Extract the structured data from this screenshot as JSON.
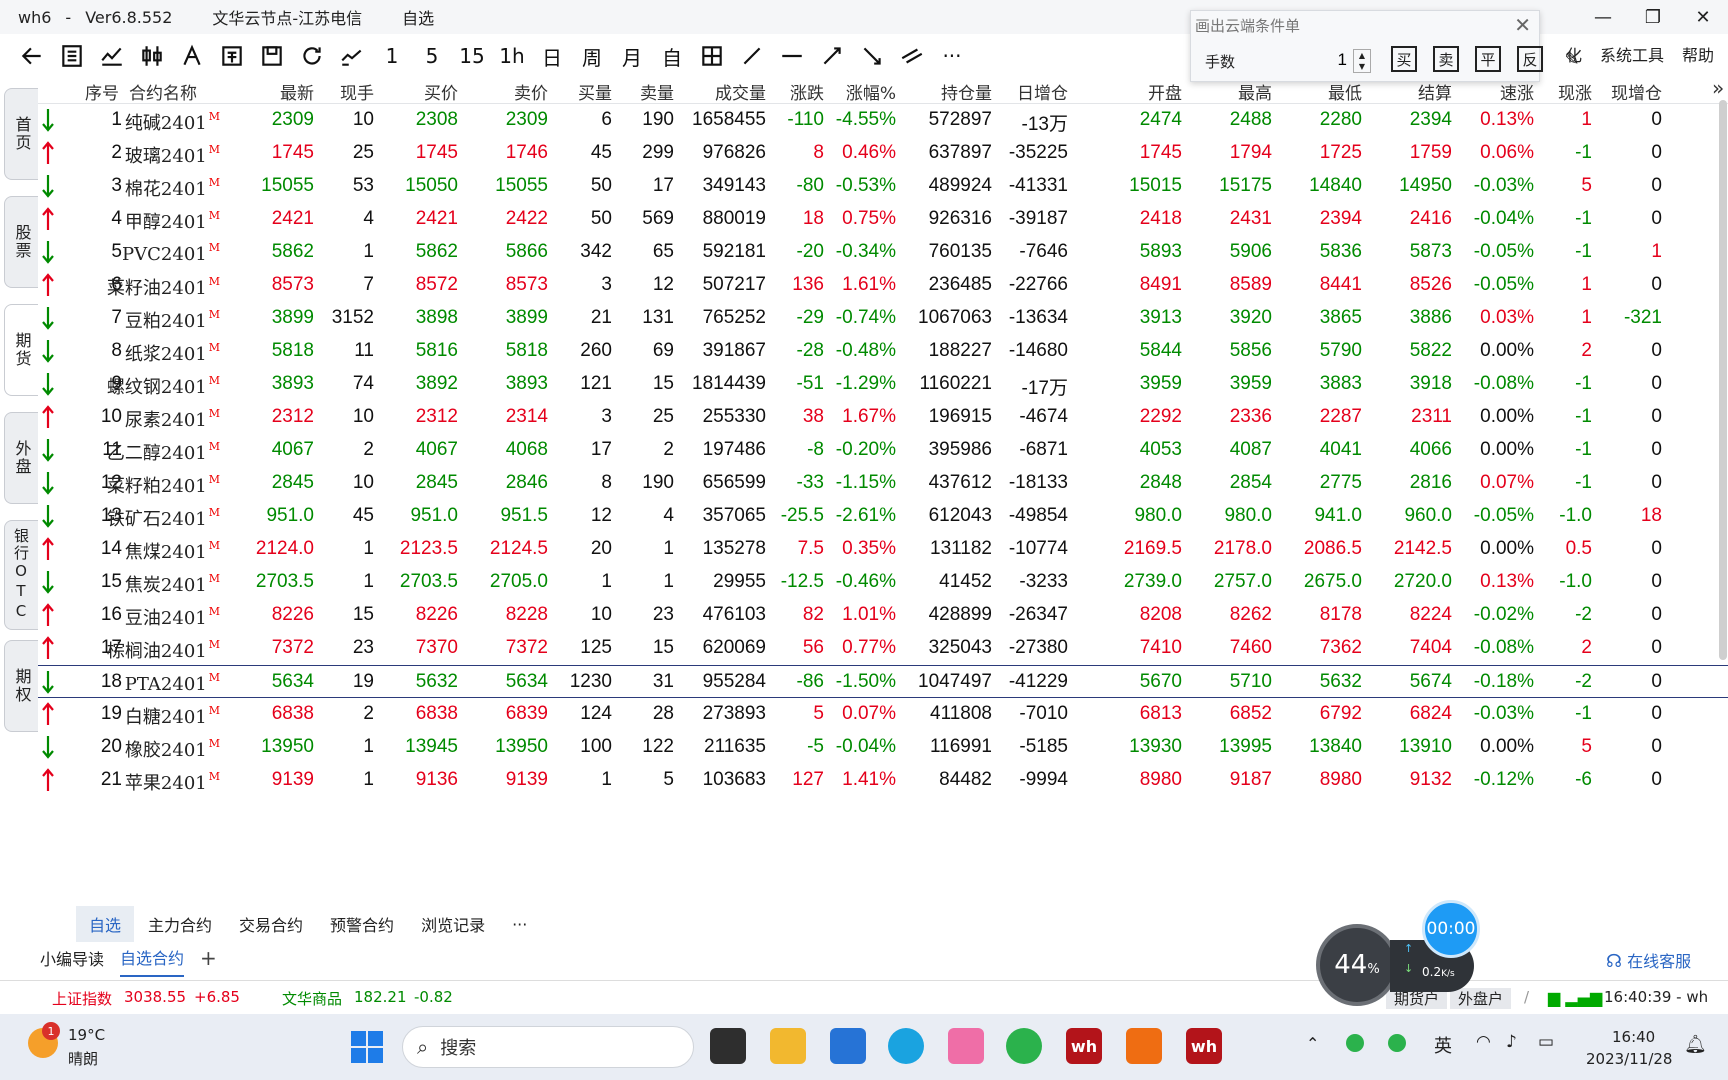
{
  "window": {
    "app": "wh6",
    "sep": "-",
    "version": "Ver6.8.552",
    "server": "文华云节点-江苏电信",
    "page": "自选",
    "controls": [
      "—",
      "❐",
      "✕"
    ]
  },
  "toolbar": {
    "buttons": [
      "back",
      "list",
      "line-chart",
      "candle",
      "k-line",
      "region",
      "save",
      "refresh",
      "indicator"
    ],
    "periods": [
      "1",
      "5",
      "15",
      "1h",
      "日",
      "周",
      "月",
      "自"
    ],
    "draw_tools": [
      "grid",
      "draw-line",
      "horizontal-line",
      "ray",
      "down-ray",
      "parallel",
      "more"
    ],
    "more": "···"
  },
  "right_menu": [
    "化",
    "系统工具",
    "帮助"
  ],
  "cond_panel": {
    "title": "画出云端条件单",
    "close": "✕",
    "qty_label": "手数",
    "qty_value": "1",
    "buttons": [
      "买",
      "卖",
      "平",
      "反"
    ],
    "pen": "✎"
  },
  "side_tabs": [
    "首页",
    "股票",
    "期货",
    "外盘",
    "银行OTC",
    "期权"
  ],
  "columns": [
    "序号",
    "合约名称",
    "最新",
    "现手",
    "买价",
    "卖价",
    "买量",
    "卖量",
    "成交量",
    "涨跌",
    "涨幅%",
    "持仓量",
    "日增仓",
    "开盘",
    "最高",
    "最低",
    "结算",
    "速涨",
    "现涨",
    "现增仓"
  ],
  "col_overflow": "»",
  "badge": "M",
  "rows": [
    {
      "no": "1",
      "name": "纯碱2401",
      "dir": "down",
      "last": "2309",
      "vol_now": "10",
      "bid": "2308",
      "ask": "2309",
      "bid_qty": "6",
      "ask_qty": "190",
      "volume": "1658455",
      "chg": "-110",
      "pct": "-4.55%",
      "oi": "572897",
      "oi_day": "-13万",
      "open": "2474",
      "high": "2488",
      "low": "2280",
      "settle": "2394",
      "speed": "0.13%",
      "now_chg": "1",
      "now_oi": "0"
    },
    {
      "no": "2",
      "name": "玻璃2401",
      "dir": "up",
      "last": "1745",
      "vol_now": "25",
      "bid": "1745",
      "ask": "1746",
      "bid_qty": "45",
      "ask_qty": "299",
      "volume": "976826",
      "chg": "8",
      "pct": "0.46%",
      "oi": "637897",
      "oi_day": "-35225",
      "open": "1745",
      "high": "1794",
      "low": "1725",
      "settle": "1759",
      "speed": "0.06%",
      "now_chg": "-1",
      "now_oi": "0"
    },
    {
      "no": "3",
      "name": "棉花2401",
      "dir": "down",
      "last": "15055",
      "vol_now": "53",
      "bid": "15050",
      "ask": "15055",
      "bid_qty": "50",
      "ask_qty": "17",
      "volume": "349143",
      "chg": "-80",
      "pct": "-0.53%",
      "oi": "489924",
      "oi_day": "-41331",
      "open": "15015",
      "high": "15175",
      "low": "14840",
      "settle": "14950",
      "speed": "-0.03%",
      "now_chg": "5",
      "now_oi": "0"
    },
    {
      "no": "4",
      "name": "甲醇2401",
      "dir": "up",
      "last": "2421",
      "vol_now": "4",
      "bid": "2421",
      "ask": "2422",
      "bid_qty": "50",
      "ask_qty": "569",
      "volume": "880019",
      "chg": "18",
      "pct": "0.75%",
      "oi": "926316",
      "oi_day": "-39187",
      "open": "2418",
      "high": "2431",
      "low": "2394",
      "settle": "2416",
      "speed": "-0.04%",
      "now_chg": "-1",
      "now_oi": "0"
    },
    {
      "no": "5",
      "name": "PVC2401",
      "dir": "down",
      "last": "5862",
      "vol_now": "1",
      "bid": "5862",
      "ask": "5866",
      "bid_qty": "342",
      "ask_qty": "65",
      "volume": "592181",
      "chg": "-20",
      "pct": "-0.34%",
      "oi": "760135",
      "oi_day": "-7646",
      "open": "5893",
      "high": "5906",
      "low": "5836",
      "settle": "5873",
      "speed": "-0.05%",
      "now_chg": "-1",
      "now_oi": "1"
    },
    {
      "no": "6",
      "name": "菜籽油2401",
      "dir": "up",
      "last": "8573",
      "vol_now": "7",
      "bid": "8572",
      "ask": "8573",
      "bid_qty": "3",
      "ask_qty": "12",
      "volume": "507217",
      "chg": "136",
      "pct": "1.61%",
      "oi": "236485",
      "oi_day": "-22766",
      "open": "8491",
      "high": "8589",
      "low": "8441",
      "settle": "8526",
      "speed": "-0.05%",
      "now_chg": "1",
      "now_oi": "0"
    },
    {
      "no": "7",
      "name": "豆粕2401",
      "dir": "down",
      "last": "3899",
      "vol_now": "3152",
      "bid": "3898",
      "ask": "3899",
      "bid_qty": "21",
      "ask_qty": "131",
      "volume": "765252",
      "chg": "-29",
      "pct": "-0.74%",
      "oi": "1067063",
      "oi_day": "-13634",
      "open": "3913",
      "high": "3920",
      "low": "3865",
      "settle": "3886",
      "speed": "0.03%",
      "now_chg": "1",
      "now_oi": "-321"
    },
    {
      "no": "8",
      "name": "纸浆2401",
      "dir": "down",
      "last": "5818",
      "vol_now": "11",
      "bid": "5816",
      "ask": "5818",
      "bid_qty": "260",
      "ask_qty": "69",
      "volume": "391867",
      "chg": "-28",
      "pct": "-0.48%",
      "oi": "188227",
      "oi_day": "-14680",
      "open": "5844",
      "high": "5856",
      "low": "5790",
      "settle": "5822",
      "speed": "0.00%",
      "now_chg": "2",
      "now_oi": "0"
    },
    {
      "no": "9",
      "name": "螺纹钢2401",
      "dir": "down",
      "last": "3893",
      "vol_now": "74",
      "bid": "3892",
      "ask": "3893",
      "bid_qty": "121",
      "ask_qty": "15",
      "volume": "1814439",
      "chg": "-51",
      "pct": "-1.29%",
      "oi": "1160221",
      "oi_day": "-17万",
      "open": "3959",
      "high": "3959",
      "low": "3883",
      "settle": "3918",
      "speed": "-0.08%",
      "now_chg": "-1",
      "now_oi": "0"
    },
    {
      "no": "10",
      "name": "尿素2401",
      "dir": "up",
      "last": "2312",
      "vol_now": "10",
      "bid": "2312",
      "ask": "2314",
      "bid_qty": "3",
      "ask_qty": "25",
      "volume": "255330",
      "chg": "38",
      "pct": "1.67%",
      "oi": "196915",
      "oi_day": "-4674",
      "open": "2292",
      "high": "2336",
      "low": "2287",
      "settle": "2311",
      "speed": "0.00%",
      "now_chg": "-1",
      "now_oi": "0"
    },
    {
      "no": "11",
      "name": "乙二醇2401",
      "dir": "down",
      "last": "4067",
      "vol_now": "2",
      "bid": "4067",
      "ask": "4068",
      "bid_qty": "17",
      "ask_qty": "2",
      "volume": "197486",
      "chg": "-8",
      "pct": "-0.20%",
      "oi": "395986",
      "oi_day": "-6871",
      "open": "4053",
      "high": "4087",
      "low": "4041",
      "settle": "4066",
      "speed": "0.00%",
      "now_chg": "-1",
      "now_oi": "0"
    },
    {
      "no": "12",
      "name": "菜籽粕2401",
      "dir": "down",
      "last": "2845",
      "vol_now": "10",
      "bid": "2845",
      "ask": "2846",
      "bid_qty": "8",
      "ask_qty": "190",
      "volume": "656599",
      "chg": "-33",
      "pct": "-1.15%",
      "oi": "437612",
      "oi_day": "-18133",
      "open": "2848",
      "high": "2854",
      "low": "2775",
      "settle": "2816",
      "speed": "0.07%",
      "now_chg": "-1",
      "now_oi": "0"
    },
    {
      "no": "13",
      "name": "铁矿石2401",
      "dir": "down",
      "last": "951.0",
      "vol_now": "45",
      "bid": "951.0",
      "ask": "951.5",
      "bid_qty": "12",
      "ask_qty": "4",
      "volume": "357065",
      "chg": "-25.5",
      "pct": "-2.61%",
      "oi": "612043",
      "oi_day": "-49854",
      "open": "980.0",
      "high": "980.0",
      "low": "941.0",
      "settle": "960.0",
      "speed": "-0.05%",
      "now_chg": "-1.0",
      "now_oi": "18"
    },
    {
      "no": "14",
      "name": "焦煤2401",
      "dir": "up",
      "last": "2124.0",
      "vol_now": "1",
      "bid": "2123.5",
      "ask": "2124.5",
      "bid_qty": "20",
      "ask_qty": "1",
      "volume": "135278",
      "chg": "7.5",
      "pct": "0.35%",
      "oi": "131182",
      "oi_day": "-10774",
      "open": "2169.5",
      "high": "2178.0",
      "low": "2086.5",
      "settle": "2142.5",
      "speed": "0.00%",
      "now_chg": "0.5",
      "now_oi": "0"
    },
    {
      "no": "15",
      "name": "焦炭2401",
      "dir": "down",
      "last": "2703.5",
      "vol_now": "1",
      "bid": "2703.5",
      "ask": "2705.0",
      "bid_qty": "1",
      "ask_qty": "1",
      "volume": "29955",
      "chg": "-12.5",
      "pct": "-0.46%",
      "oi": "41452",
      "oi_day": "-3233",
      "open": "2739.0",
      "high": "2757.0",
      "low": "2675.0",
      "settle": "2720.0",
      "speed": "0.13%",
      "now_chg": "-1.0",
      "now_oi": "0"
    },
    {
      "no": "16",
      "name": "豆油2401",
      "dir": "up",
      "last": "8226",
      "vol_now": "15",
      "bid": "8226",
      "ask": "8228",
      "bid_qty": "10",
      "ask_qty": "23",
      "volume": "476103",
      "chg": "82",
      "pct": "1.01%",
      "oi": "428899",
      "oi_day": "-26347",
      "open": "8208",
      "high": "8262",
      "low": "8178",
      "settle": "8224",
      "speed": "-0.02%",
      "now_chg": "-2",
      "now_oi": "0"
    },
    {
      "no": "17",
      "name": "棕榈油2401",
      "dir": "up",
      "last": "7372",
      "vol_now": "23",
      "bid": "7370",
      "ask": "7372",
      "bid_qty": "125",
      "ask_qty": "15",
      "volume": "620069",
      "chg": "56",
      "pct": "0.77%",
      "oi": "325043",
      "oi_day": "-27380",
      "open": "7410",
      "high": "7460",
      "low": "7362",
      "settle": "7404",
      "speed": "-0.08%",
      "now_chg": "2",
      "now_oi": "0"
    },
    {
      "no": "18",
      "name": "PTA2401",
      "dir": "down",
      "last": "5634",
      "vol_now": "19",
      "bid": "5632",
      "ask": "5634",
      "bid_qty": "1230",
      "ask_qty": "31",
      "volume": "955284",
      "chg": "-86",
      "pct": "-1.50%",
      "oi": "1047497",
      "oi_day": "-41229",
      "open": "5670",
      "high": "5710",
      "low": "5632",
      "settle": "5674",
      "speed": "-0.18%",
      "now_chg": "-2",
      "now_oi": "0",
      "selected": true
    },
    {
      "no": "19",
      "name": "白糖2401",
      "dir": "up",
      "last": "6838",
      "vol_now": "2",
      "bid": "6838",
      "ask": "6839",
      "bid_qty": "124",
      "ask_qty": "28",
      "volume": "273893",
      "chg": "5",
      "pct": "0.07%",
      "oi": "411808",
      "oi_day": "-7010",
      "open": "6813",
      "high": "6852",
      "low": "6792",
      "settle": "6824",
      "speed": "-0.03%",
      "now_chg": "-1",
      "now_oi": "0"
    },
    {
      "no": "20",
      "name": "橡胶2401",
      "dir": "down",
      "last": "13950",
      "vol_now": "1",
      "bid": "13945",
      "ask": "13950",
      "bid_qty": "100",
      "ask_qty": "122",
      "volume": "211635",
      "chg": "-5",
      "pct": "-0.04%",
      "oi": "116991",
      "oi_day": "-5185",
      "open": "13930",
      "high": "13995",
      "low": "13840",
      "settle": "13910",
      "speed": "0.00%",
      "now_chg": "5",
      "now_oi": "0"
    },
    {
      "no": "21",
      "name": "苹果2401",
      "dir": "up",
      "last": "9139",
      "vol_now": "1",
      "bid": "9136",
      "ask": "9139",
      "bid_qty": "1",
      "ask_qty": "5",
      "volume": "103683",
      "chg": "127",
      "pct": "1.41%",
      "oi": "84482",
      "oi_day": "-9994",
      "open": "8980",
      "high": "9187",
      "low": "8980",
      "settle": "9132",
      "speed": "-0.12%",
      "now_chg": "-6",
      "now_oi": "0"
    }
  ],
  "bottom_tabs": [
    "自选",
    "主力合约",
    "交易合约",
    "预警合约",
    "浏览记录"
  ],
  "bottom_more": "···",
  "sub_tabs": [
    "小编导读",
    "自选合约"
  ],
  "sub_plus": "+",
  "online_service": "在线客服",
  "status": {
    "idx1_name": "上证指数",
    "idx1_val": "3038.55",
    "idx1_chg": "+6.85",
    "idx2_name": "文华商品",
    "idx2_val": "182.21",
    "idx2_chg": "-0.82",
    "acct1": "期货户",
    "acct2": "外盘户",
    "sep": "/",
    "clock": "16:40:39 - wh"
  },
  "widgets": {
    "gauge": "44",
    "gauge_unit": "%",
    "speed": "0.2",
    "speed_unit": "K/s",
    "timer": "00:00"
  },
  "taskbar": {
    "weather_badge": "1",
    "temp": "19°C",
    "weather": "晴朗",
    "search": "搜索",
    "lang": "英",
    "time": "16:40",
    "date": "2023/11/28"
  },
  "colors": {
    "up": "#e4001b",
    "down": "#008a00",
    "selected_border": "#2b3a7a",
    "accent": "#2a66c4"
  }
}
